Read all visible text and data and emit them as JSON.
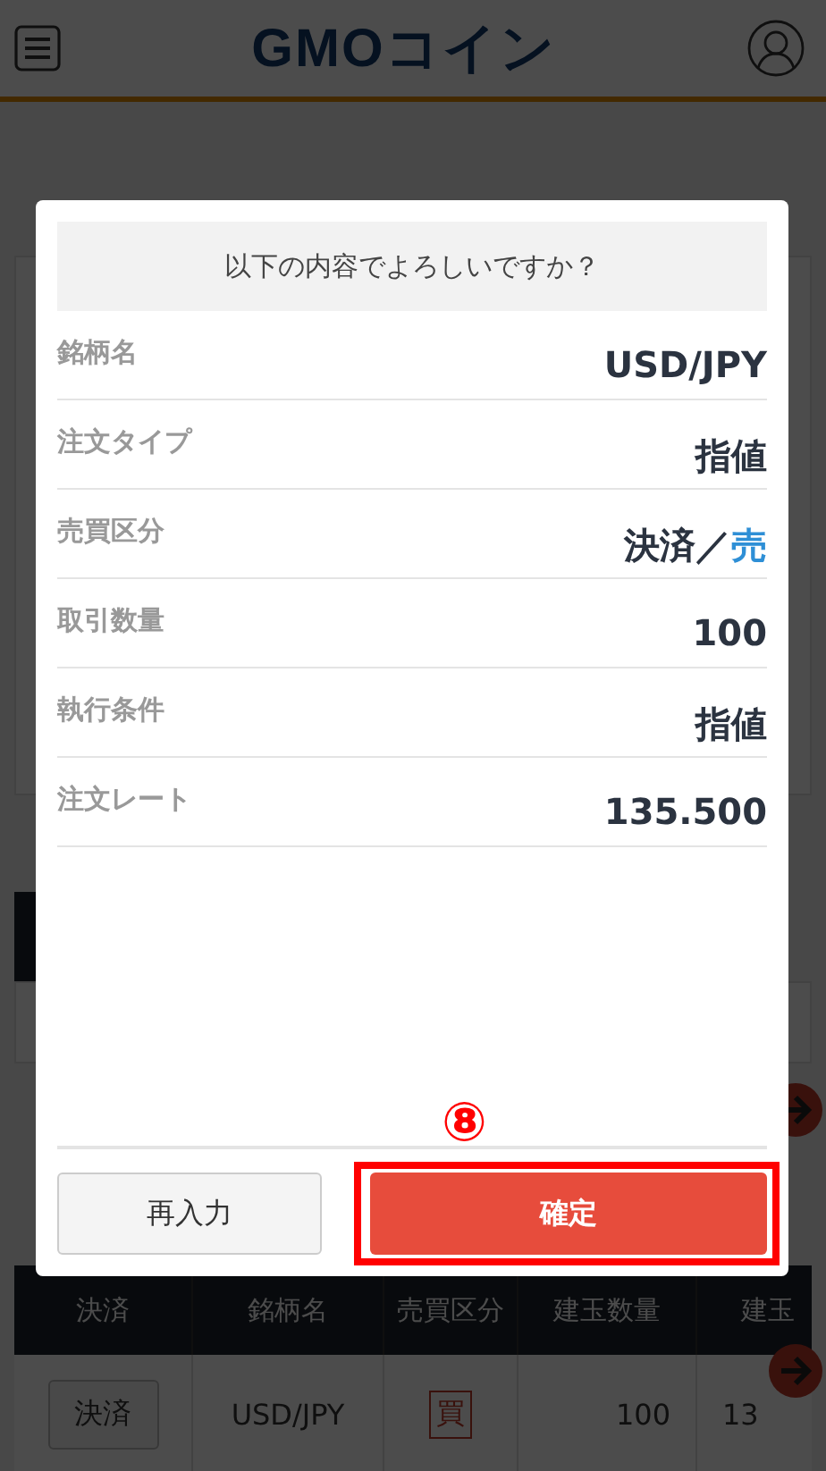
{
  "header": {
    "logo": "GMOコイン"
  },
  "positions_table": {
    "columns": [
      "決済",
      "銘柄名",
      "売買区分",
      "建玉数量",
      "建玉"
    ],
    "rows": [
      {
        "action": "決済",
        "symbol": "USD/JPY",
        "side": "買",
        "quantity": "100",
        "column_5": "13"
      }
    ]
  },
  "dialog": {
    "message": "以下の内容でよろしいですか？",
    "fields": [
      {
        "label": "銘柄名",
        "parts": [
          {
            "text": "USD/JPY",
            "kind": "plain"
          }
        ]
      },
      {
        "label": "注文タイプ",
        "parts": [
          {
            "text": "指値",
            "kind": "plain"
          }
        ]
      },
      {
        "label": "売買区分",
        "parts": [
          {
            "text": "決済／",
            "kind": "plain"
          },
          {
            "text": "売",
            "kind": "sell"
          }
        ]
      },
      {
        "label": "取引数量",
        "parts": [
          {
            "text": "100",
            "kind": "plain"
          }
        ]
      },
      {
        "label": "執行条件",
        "parts": [
          {
            "text": "指値",
            "kind": "plain"
          }
        ]
      },
      {
        "label": "注文レート",
        "parts": [
          {
            "text": "135.500",
            "kind": "plain"
          }
        ]
      }
    ],
    "buttons": [
      {
        "label": "再入力",
        "kind": "secondary"
      },
      {
        "label": "確定",
        "kind": "primary"
      }
    ]
  },
  "annotation": {
    "label": "⑧"
  }
}
